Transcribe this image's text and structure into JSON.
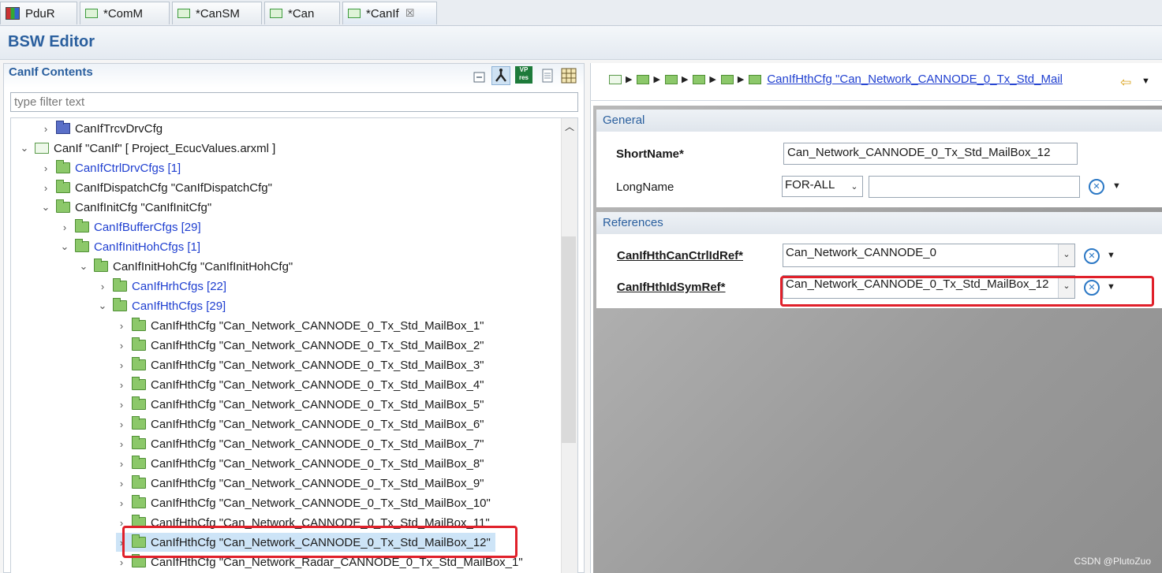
{
  "tabs": [
    {
      "label": "PduR",
      "icon": "pdur-module-icon",
      "active": false
    },
    {
      "label": "*ComM",
      "icon": "config-frame-icon",
      "active": false
    },
    {
      "label": "*CanSM",
      "icon": "config-frame-icon",
      "active": false
    },
    {
      "label": "*Can",
      "icon": "config-frame-icon",
      "active": false
    },
    {
      "label": "*CanIf",
      "icon": "config-frame-icon",
      "active": true,
      "close": "☒"
    }
  ],
  "editor": {
    "title": "BSW Editor"
  },
  "contents": {
    "title": "CanIf Contents",
    "filter_placeholder": "type filter text",
    "toolbar": {
      "vp_label_top": "VP",
      "vp_label_bottom": "res"
    }
  },
  "tree": [
    {
      "label": "CanIfTrcvDrvCfg",
      "arrow": "›",
      "folder": "blue",
      "link": false
    },
    {
      "label": "CanIf \"CanIf\" [ Project_EcucValues.arxml ]",
      "arrow": "⌄",
      "folder": "frame",
      "link": false
    },
    {
      "label": "CanIfCtrlDrvCfgs [1]",
      "arrow": "›",
      "folder": "green",
      "link": true
    },
    {
      "label": "CanIfDispatchCfg \"CanIfDispatchCfg\"",
      "arrow": "›",
      "folder": "green",
      "link": false
    },
    {
      "label": "CanIfInitCfg \"CanIfInitCfg\"",
      "arrow": "⌄",
      "folder": "green",
      "link": false
    },
    {
      "label": "CanIfBufferCfgs [29]",
      "arrow": "›",
      "folder": "green",
      "link": true
    },
    {
      "label": "CanIfInitHohCfgs [1]",
      "arrow": "⌄",
      "folder": "green",
      "link": true
    },
    {
      "label": "CanIfInitHohCfg \"CanIfInitHohCfg\"",
      "arrow": "⌄",
      "folder": "green",
      "link": false
    },
    {
      "label": "CanIfHrhCfgs [22]",
      "arrow": "›",
      "folder": "green",
      "link": true
    },
    {
      "label": "CanIfHthCfgs [29]",
      "arrow": "⌄",
      "folder": "green",
      "link": true
    },
    {
      "label": "CanIfHthCfg \"Can_Network_CANNODE_0_Tx_Std_MailBox_1\"",
      "arrow": "›",
      "folder": "green",
      "link": false
    },
    {
      "label": "CanIfHthCfg \"Can_Network_CANNODE_0_Tx_Std_MailBox_2\"",
      "arrow": "›",
      "folder": "green",
      "link": false
    },
    {
      "label": "CanIfHthCfg \"Can_Network_CANNODE_0_Tx_Std_MailBox_3\"",
      "arrow": "›",
      "folder": "green",
      "link": false
    },
    {
      "label": "CanIfHthCfg \"Can_Network_CANNODE_0_Tx_Std_MailBox_4\"",
      "arrow": "›",
      "folder": "green",
      "link": false
    },
    {
      "label": "CanIfHthCfg \"Can_Network_CANNODE_0_Tx_Std_MailBox_5\"",
      "arrow": "›",
      "folder": "green",
      "link": false
    },
    {
      "label": "CanIfHthCfg \"Can_Network_CANNODE_0_Tx_Std_MailBox_6\"",
      "arrow": "›",
      "folder": "green",
      "link": false
    },
    {
      "label": "CanIfHthCfg \"Can_Network_CANNODE_0_Tx_Std_MailBox_7\"",
      "arrow": "›",
      "folder": "green",
      "link": false
    },
    {
      "label": "CanIfHthCfg \"Can_Network_CANNODE_0_Tx_Std_MailBox_8\"",
      "arrow": "›",
      "folder": "green",
      "link": false
    },
    {
      "label": "CanIfHthCfg \"Can_Network_CANNODE_0_Tx_Std_MailBox_9\"",
      "arrow": "›",
      "folder": "green",
      "link": false
    },
    {
      "label": "CanIfHthCfg \"Can_Network_CANNODE_0_Tx_Std_MailBox_10\"",
      "arrow": "›",
      "folder": "green",
      "link": false
    },
    {
      "label": "CanIfHthCfg \"Can_Network_CANNODE_0_Tx_Std_MailBox_11\"",
      "arrow": "›",
      "folder": "green",
      "link": false
    },
    {
      "label": "CanIfHthCfg \"Can_Network_CANNODE_0_Tx_Std_MailBox_12\"",
      "arrow": "›",
      "folder": "green",
      "link": false,
      "selected": true
    },
    {
      "label": "CanIfHthCfg \"Can_Network_Radar_CANNODE_0_Tx_Std_MailBox_1\"",
      "arrow": "›",
      "folder": "green",
      "link": false
    }
  ],
  "breadcrumb": {
    "link": "CanIfHthCfg \"Can_Network_CANNODE_0_Tx_Std_Mail"
  },
  "general": {
    "header": "General",
    "shortname_label": "ShortName*",
    "shortname_value": "Can_Network_CANNODE_0_Tx_Std_MailBox_12",
    "longname_label": "LongName",
    "longname_lang": "FOR-ALL",
    "longname_value": ""
  },
  "references": {
    "header": "References",
    "ctrl_label": "CanIfHthCanCtrlIdRef*",
    "ctrl_value": "Can_Network_CANNODE_0",
    "sym_label": "CanIfHthIdSymRef*",
    "sym_value": "Can_Network_CANNODE_0_Tx_Std_MailBox_12"
  },
  "watermark": "CSDN @PlutoZuo",
  "colors": {
    "highlight": "#e0202a",
    "accent": "#2a5f9e",
    "link": "#1f3fd0"
  }
}
